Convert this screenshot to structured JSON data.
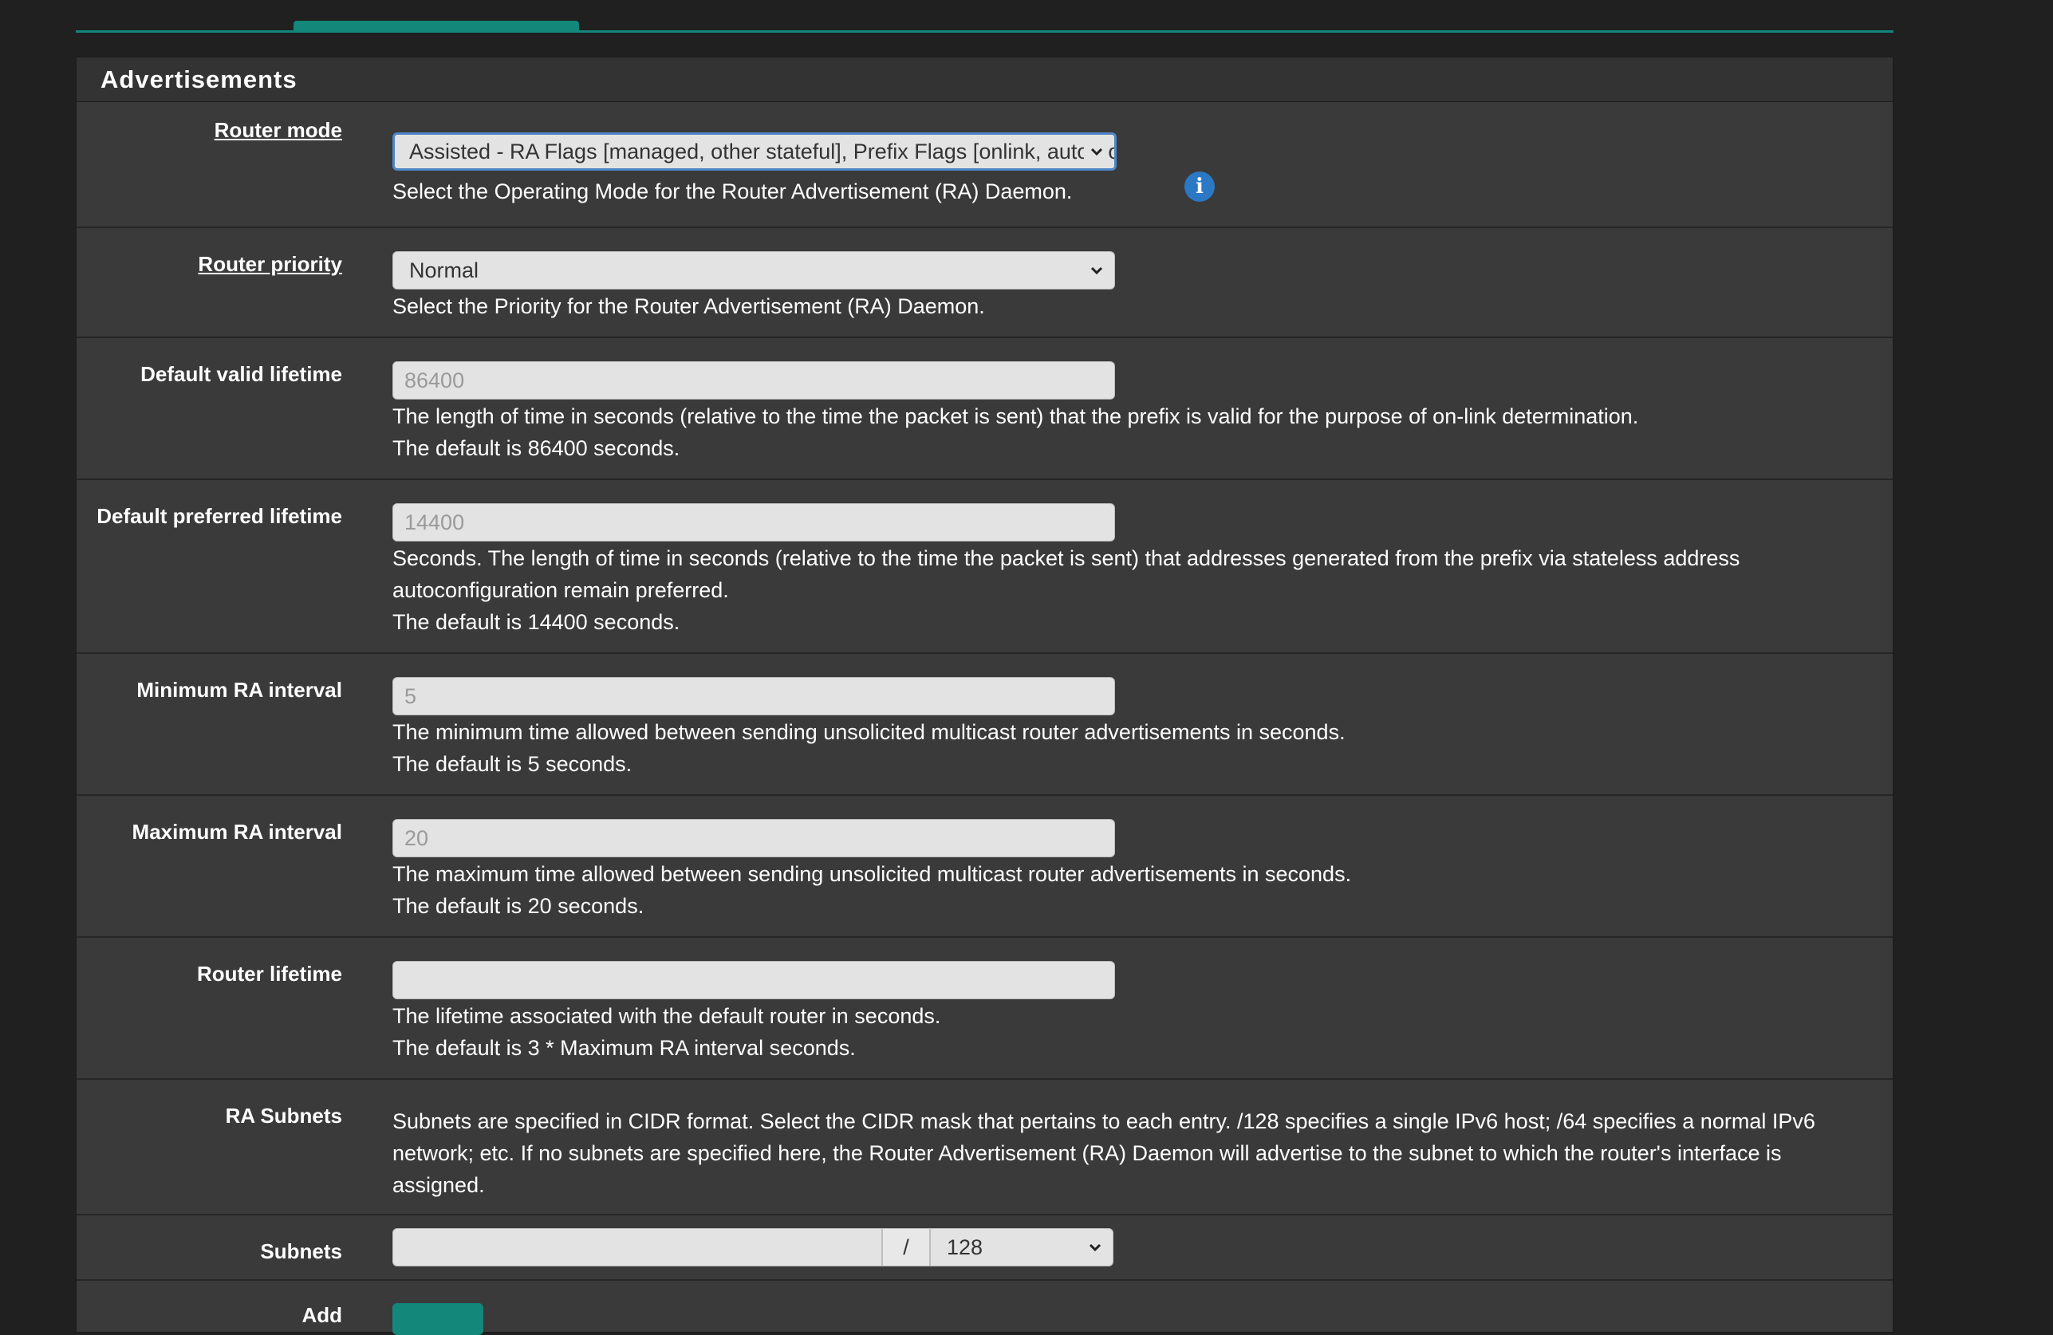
{
  "panel": {
    "title": "Advertisements"
  },
  "router_mode": {
    "label": "Router mode",
    "value": "Assisted - RA Flags [managed, other stateful], Prefix Flags [onlink, auto, router]",
    "help": "Select the Operating Mode for the Router Advertisement (RA) Daemon.",
    "info_icon": "i"
  },
  "router_priority": {
    "label": "Router priority",
    "value": "Normal",
    "help": "Select the Priority for the Router Advertisement (RA) Daemon."
  },
  "default_valid_lifetime": {
    "label": "Default valid lifetime",
    "placeholder": "86400",
    "help_lines": [
      "The length of time in seconds (relative to the time the packet is sent) that the prefix is valid for the purpose of on-link determination.",
      "The default is 86400 seconds."
    ]
  },
  "default_preferred_lifetime": {
    "label": "Default preferred lifetime",
    "placeholder": "14400",
    "help_lines": [
      "Seconds. The length of time in seconds (relative to the time the packet is sent) that addresses generated from the prefix via stateless address",
      "autoconfiguration remain preferred.",
      "The default is 14400 seconds."
    ]
  },
  "min_ra_interval": {
    "label": "Minimum RA interval",
    "placeholder": "5",
    "help_lines": [
      "The minimum time allowed between sending unsolicited multicast router advertisements in seconds.",
      "The default is 5 seconds."
    ]
  },
  "max_ra_interval": {
    "label": "Maximum RA interval",
    "placeholder": "20",
    "help_lines": [
      "The maximum time allowed between sending unsolicited multicast router advertisements in seconds.",
      "The default is 20 seconds."
    ]
  },
  "router_lifetime": {
    "label": "Router lifetime",
    "placeholder": "",
    "help_lines": [
      "The lifetime associated with the default router in seconds.",
      "The default is 3 * Maximum RA interval seconds."
    ]
  },
  "ra_subnets": {
    "label": "RA Subnets",
    "help_lines": [
      "Subnets are specified in CIDR format. Select the CIDR mask that pertains to each entry. /128 specifies a single IPv6 host; /64 specifies a normal IPv6",
      "network; etc. If no subnets are specified here, the Router Advertisement (RA) Daemon will advertise to the subnet to which the router's interface is",
      "assigned."
    ]
  },
  "subnets": {
    "label": "Subnets",
    "separator": "/",
    "mask": "128"
  },
  "add": {
    "label": "Add"
  },
  "colors": {
    "accent": "#12877a",
    "panel_bg": "#3a3a3a",
    "page_bg": "#202020",
    "info": "#2b78c5"
  }
}
